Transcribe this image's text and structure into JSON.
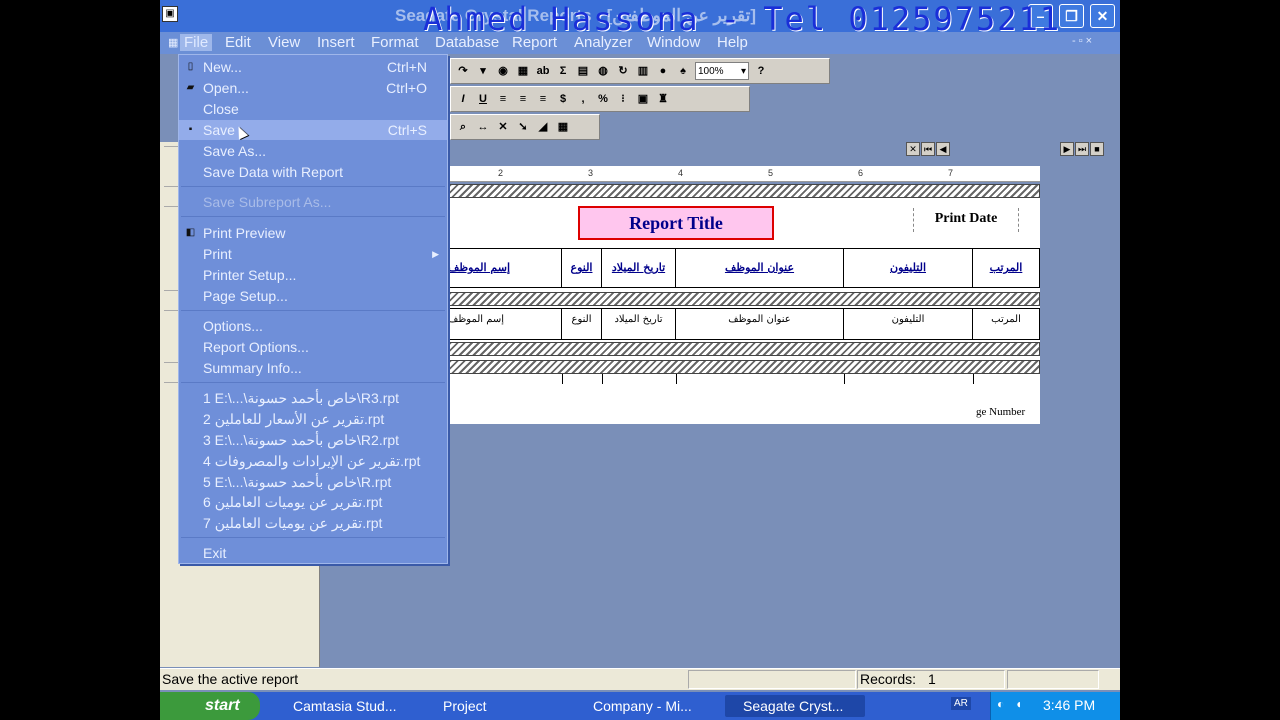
{
  "window": {
    "title": "Seagate Crystal Reports - [تقرير عن الموظفين]",
    "watermark": "Ahmed Hassona - Tel 0125975211"
  },
  "menubar": {
    "items": [
      "File",
      "Edit",
      "View",
      "Insert",
      "Format",
      "Database",
      "Report",
      "Analyzer",
      "Window",
      "Help"
    ],
    "mdi_controls": "- ▫ ×"
  },
  "file_menu": {
    "items": [
      {
        "label": "New...",
        "shortcut": "Ctrl+N",
        "icon": "new-doc-icon"
      },
      {
        "label": "Open...",
        "shortcut": "Ctrl+O",
        "icon": "open-folder-icon"
      },
      {
        "label": "Close",
        "shortcut": ""
      },
      {
        "label": "Save",
        "shortcut": "Ctrl+S",
        "icon": "floppy-icon"
      },
      {
        "label": "Save As...",
        "shortcut": ""
      },
      {
        "label": "Save Data with Report",
        "shortcut": ""
      },
      {
        "label": "Save Subreport As...",
        "shortcut": ""
      },
      {
        "label": "Print Preview",
        "shortcut": "",
        "icon": "print-preview-icon"
      },
      {
        "label": "Print",
        "shortcut": ""
      },
      {
        "label": "Printer Setup...",
        "shortcut": ""
      },
      {
        "label": "Page Setup...",
        "shortcut": ""
      },
      {
        "label": "Options...",
        "shortcut": ""
      },
      {
        "label": "Report Options...",
        "shortcut": ""
      },
      {
        "label": "Summary Info...",
        "shortcut": ""
      },
      {
        "label": "1 E:\\...\\خاص بأحمد حسونة\\R3.rpt",
        "shortcut": ""
      },
      {
        "label": "2 تقرير عن الأسعار للعاملين.rpt",
        "shortcut": ""
      },
      {
        "label": "3 E:\\...\\خاص بأحمد حسونة\\R2.rpt",
        "shortcut": ""
      },
      {
        "label": "4 تقرير عن الإيرادات والمصروفات.rpt",
        "shortcut": ""
      },
      {
        "label": "5 E:\\...\\خاص بأحمد حسونة\\R.rpt",
        "shortcut": ""
      },
      {
        "label": "6 تقرير عن يوميات العاملين.rpt",
        "shortcut": ""
      },
      {
        "label": "7 تقرير عن يوميات العاملين.rpt",
        "shortcut": ""
      },
      {
        "label": "Exit",
        "shortcut": ""
      }
    ]
  },
  "toolbar": {
    "zoom": "100%"
  },
  "ruler": {
    "marks": [
      "2",
      "3",
      "4",
      "5",
      "6",
      "7"
    ]
  },
  "report": {
    "title": "Report Title",
    "print_date": "Print Date",
    "headers": [
      "المرتب",
      "التليفون",
      "عنوان الموظف",
      "تاريخ الميلاد",
      "النوع",
      "إسم الموظف"
    ],
    "details": [
      "المرتب",
      "التليفون",
      "عنوان الموظف",
      "تاريخ الميلاد",
      "النوع",
      "إسم الموظف"
    ],
    "page_number": "ge Number"
  },
  "statusbar": {
    "message": "Save the active report",
    "records_label": "Records:",
    "records_value": "1"
  },
  "taskbar": {
    "start": "start",
    "tasks": [
      "Camtasia Stud...",
      "Project",
      "Company - Mi...",
      "Seagate Cryst..."
    ],
    "lang": "AR",
    "clock": "3:46 PM"
  }
}
